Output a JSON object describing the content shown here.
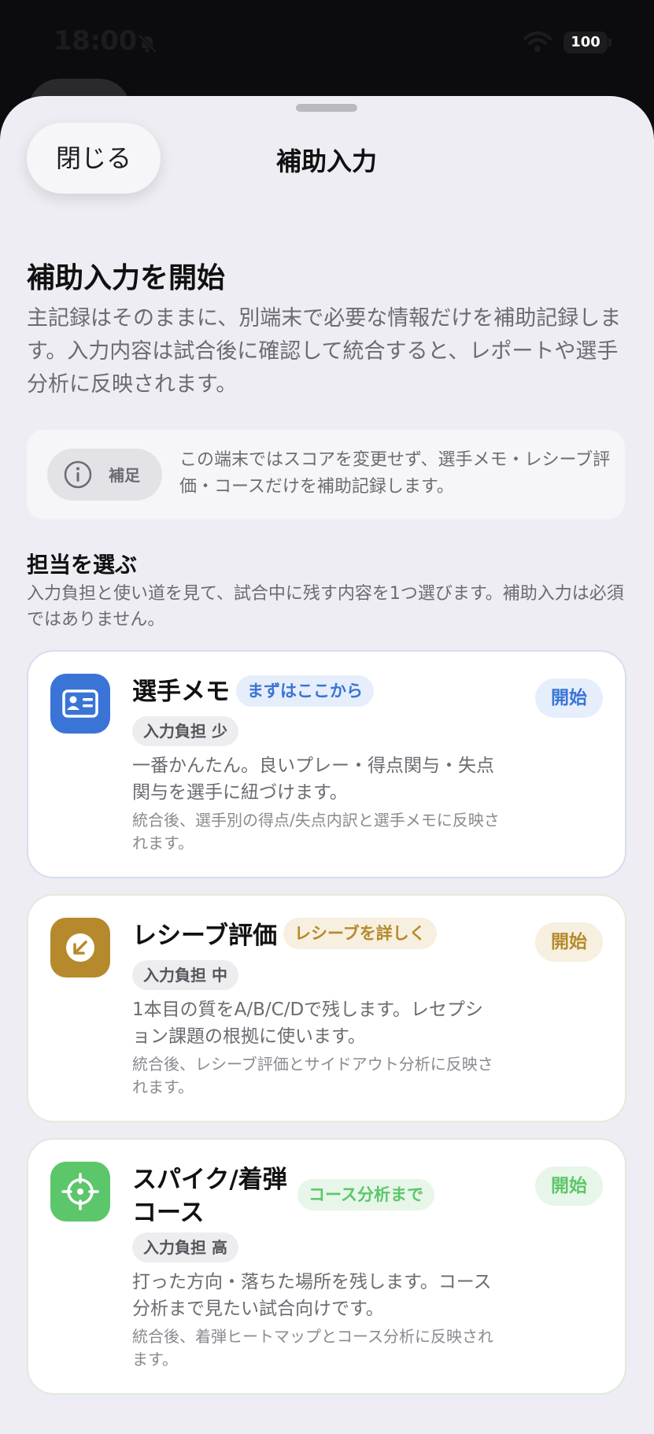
{
  "status_bar": {
    "time": "18:00",
    "battery": "100"
  },
  "header": {
    "close_label": "閉じる",
    "title": "補助入力"
  },
  "intro": {
    "heading": "補助入力を開始",
    "body": "主記録はそのままに、別端末で必要な情報だけを補助記録します。入力内容は試合後に確認して統合すると、レポートや選手分析に反映されます。"
  },
  "notice": {
    "tag": "補足",
    "text": "この端末ではスコアを変更せず、選手メモ・レシーブ評価・コースだけを補助記録します。"
  },
  "section": {
    "title": "担当を選ぶ",
    "description": "入力負担と使い道を見て、試合中に残す内容を1つ選びます。補助入力は必須ではありません。"
  },
  "options": [
    {
      "title": "選手メモ",
      "badge": "まずはここから",
      "load": "入力負担 少",
      "description": "一番かんたん。良いプレー・得点関与・失点関与を選手に紐づけます。",
      "note": "統合後、選手別の得点/失点内訳と選手メモに反映されます。",
      "start_label": "開始",
      "icon": "id-card-icon",
      "accent": "#3a74d6"
    },
    {
      "title": "レシーブ評価",
      "badge": "レシーブを詳しく",
      "load": "入力負担 中",
      "description": "1本目の質をA/B/C/Dで残します。レセプション課題の根拠に使います。",
      "note": "統合後、レシーブ評価とサイドアウト分析に反映されます。",
      "start_label": "開始",
      "icon": "arrow-down-left-icon",
      "accent": "#b68a2c"
    },
    {
      "title": "スパイク/着弾コース",
      "badge": "コース分析まで",
      "load": "入力負担 高",
      "description": "打った方向・落ちた場所を残します。コース分析まで見たい試合向けです。",
      "note": "統合後、着弾ヒートマップとコース分析に反映されます。",
      "start_label": "開始",
      "icon": "crosshair-icon",
      "accent": "#5cc66a"
    }
  ]
}
